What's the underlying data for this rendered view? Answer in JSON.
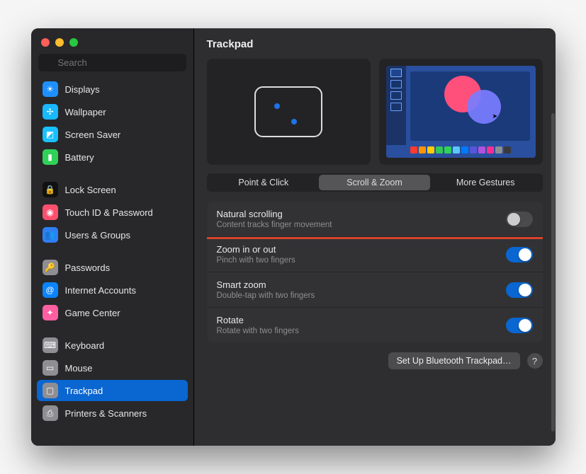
{
  "search": {
    "placeholder": "Search"
  },
  "sidebar": {
    "groups": [
      [
        {
          "label": "Displays",
          "bg": "#1e8fff",
          "glyph": "☀"
        },
        {
          "label": "Wallpaper",
          "bg": "#19b8ff",
          "glyph": "✢"
        },
        {
          "label": "Screen Saver",
          "bg": "#19c1ff",
          "glyph": "◩"
        },
        {
          "label": "Battery",
          "bg": "#30d158",
          "glyph": "▮"
        }
      ],
      [
        {
          "label": "Lock Screen",
          "bg": "#111",
          "glyph": "🔒"
        },
        {
          "label": "Touch ID & Password",
          "bg": "#ff4f6f",
          "glyph": "◉"
        },
        {
          "label": "Users & Groups",
          "bg": "#2f7ff5",
          "glyph": "👥"
        }
      ],
      [
        {
          "label": "Passwords",
          "bg": "#8e8e93",
          "glyph": "🔑"
        },
        {
          "label": "Internet Accounts",
          "bg": "#0a84ff",
          "glyph": "@"
        },
        {
          "label": "Game Center",
          "bg": "#ff5fa2",
          "glyph": "✦"
        }
      ],
      [
        {
          "label": "Keyboard",
          "bg": "#8e8e93",
          "glyph": "⌨"
        },
        {
          "label": "Mouse",
          "bg": "#8e8e93",
          "glyph": "▭"
        },
        {
          "label": "Trackpad",
          "bg": "#8e8e93",
          "glyph": "▢",
          "selected": true
        },
        {
          "label": "Printers & Scanners",
          "bg": "#8e8e93",
          "glyph": "⎙"
        }
      ]
    ]
  },
  "header": {
    "title": "Trackpad"
  },
  "tabs": {
    "items": [
      {
        "label": "Point & Click"
      },
      {
        "label": "Scroll & Zoom",
        "active": true
      },
      {
        "label": "More Gestures"
      }
    ]
  },
  "settings": [
    {
      "title": "Natural scrolling",
      "sub": "Content tracks finger movement",
      "on": false,
      "highlight": true
    },
    {
      "title": "Zoom in or out",
      "sub": "Pinch with two fingers",
      "on": true
    },
    {
      "title": "Smart zoom",
      "sub": "Double-tap with two fingers",
      "on": true
    },
    {
      "title": "Rotate",
      "sub": "Rotate with two fingers",
      "on": true
    }
  ],
  "footer": {
    "button": "Set Up Bluetooth Trackpad…",
    "help": "?"
  },
  "swatches": [
    "#ff3b30",
    "#ff9500",
    "#ffcc00",
    "#34c759",
    "#30d158",
    "#5ac8fa",
    "#007aff",
    "#5856d6",
    "#af52de",
    "#ff2d92",
    "#8e8e93",
    "#3a3a3c"
  ]
}
